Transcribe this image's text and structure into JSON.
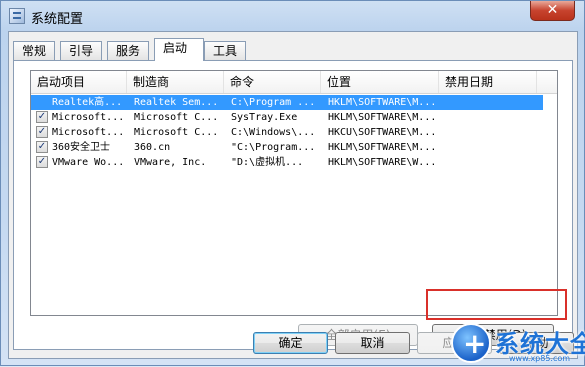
{
  "window": {
    "title": "系统配置",
    "close_label": "✕"
  },
  "tabs": [
    {
      "label": "常规",
      "active": false
    },
    {
      "label": "引导",
      "active": false
    },
    {
      "label": "服务",
      "active": false
    },
    {
      "label": "启动",
      "active": true
    },
    {
      "label": "工具",
      "active": false
    }
  ],
  "startup_table": {
    "columns": [
      "启动项目",
      "制造商",
      "命令",
      "位置",
      "禁用日期"
    ],
    "rows": [
      {
        "checked": true,
        "item": "Realtek高...",
        "maker": "Realtek Sem...",
        "command": "C:\\Program ...",
        "location": "HKLM\\SOFTWARE\\M...",
        "disabled_date": ""
      },
      {
        "checked": true,
        "item": "Microsoft...",
        "maker": "Microsoft C...",
        "command": "SysTray.Exe",
        "location": "HKLM\\SOFTWARE\\M...",
        "disabled_date": ""
      },
      {
        "checked": true,
        "item": "Microsoft...",
        "maker": "Microsoft C...",
        "command": "C:\\Windows\\...",
        "location": "HKCU\\SOFTWARE\\M...",
        "disabled_date": ""
      },
      {
        "checked": true,
        "item": "360安全卫士",
        "maker": "360.cn",
        "command": "\"C:\\Program...",
        "location": "HKLM\\SOFTWARE\\M...",
        "disabled_date": ""
      },
      {
        "checked": true,
        "item": "VMware Wo...",
        "maker": "VMware, Inc.",
        "command": "\"D:\\虚拟机...",
        "location": "HKLM\\SOFTWARE\\W...",
        "disabled_date": ""
      }
    ]
  },
  "buttons": {
    "enable_all": "全部启用(E)",
    "disable_all": "全部禁用(D)",
    "ok": "确定",
    "cancel": "取消",
    "apply": "应用",
    "help": "帮助"
  },
  "watermark": {
    "name": "系统大全",
    "url": "www.xp85.com"
  },
  "colors": {
    "selection": "#3399ff",
    "highlight_box": "#d9302a",
    "close_button": "#c7432e"
  }
}
